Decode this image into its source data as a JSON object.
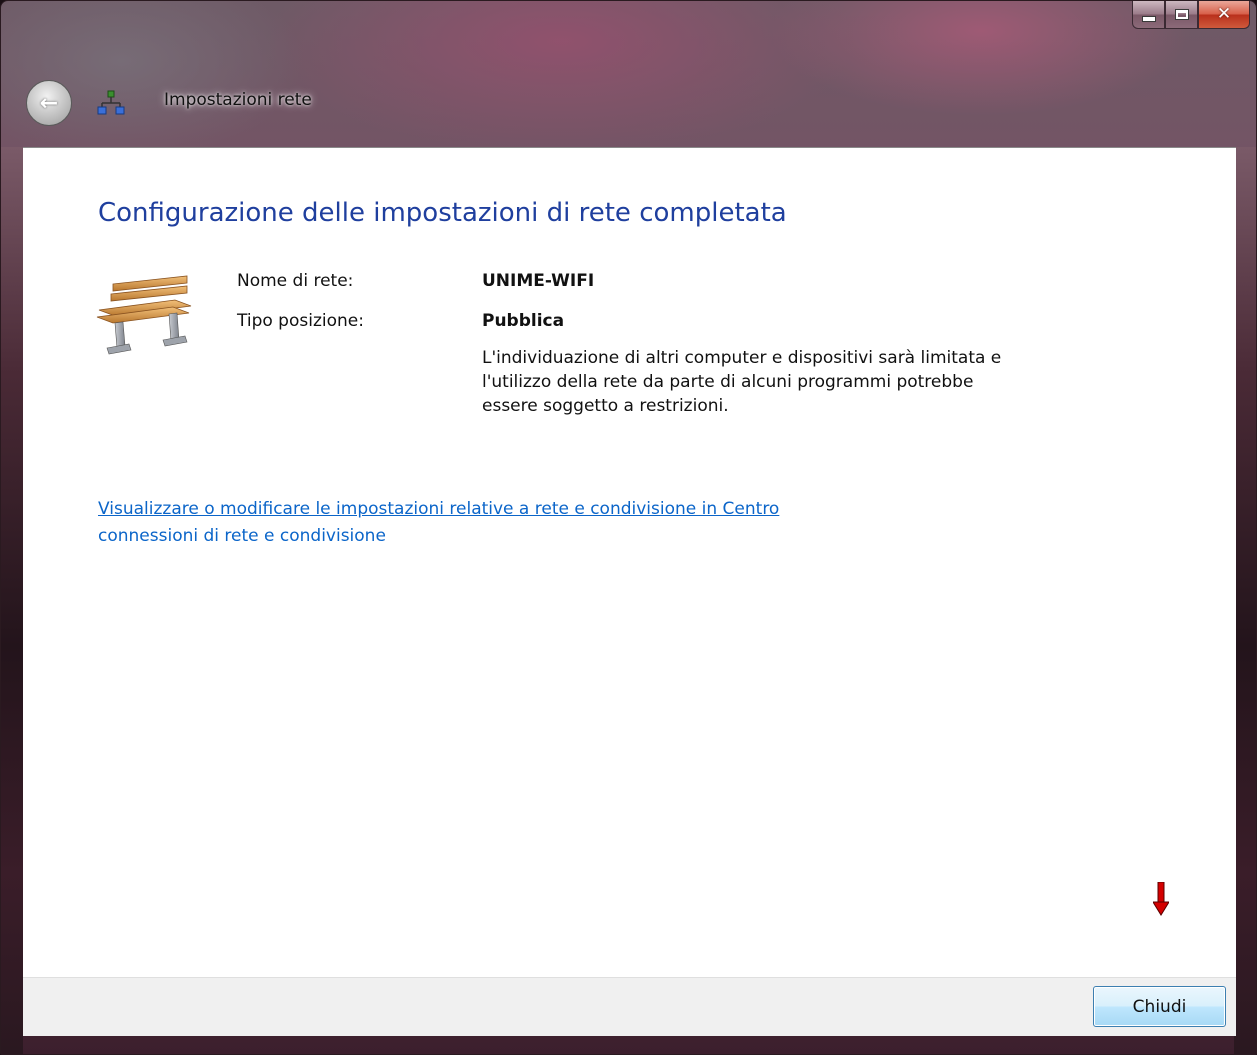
{
  "window": {
    "title": "Impostazioni rete"
  },
  "content": {
    "heading": "Configurazione delle impostazioni di rete completata",
    "network_name_label": "Nome di rete:",
    "network_name_value": "UNIME-WIFI",
    "location_type_label": "Tipo posizione:",
    "location_type_value": "Pubblica",
    "location_description": "L'individuazione di altri computer e dispositivi sarà limitata e l'utilizzo della rete da parte di alcuni programmi potrebbe essere soggetto a restrizioni.",
    "settings_link_line1": "Visualizzare o modificare le impostazioni relative a rete e condivisione in Centro",
    "settings_link_line2": "connessioni di rete e condivisione"
  },
  "footer": {
    "close_label": "Chiudi"
  },
  "icons": {
    "back": "back-arrow-icon",
    "network": "network-icon",
    "location": "park-bench-icon",
    "annotation": "red-down-arrow-icon"
  },
  "colors": {
    "heading": "#1f3f9e",
    "link": "#0b65c9",
    "annotation_arrow": "#d40000"
  }
}
